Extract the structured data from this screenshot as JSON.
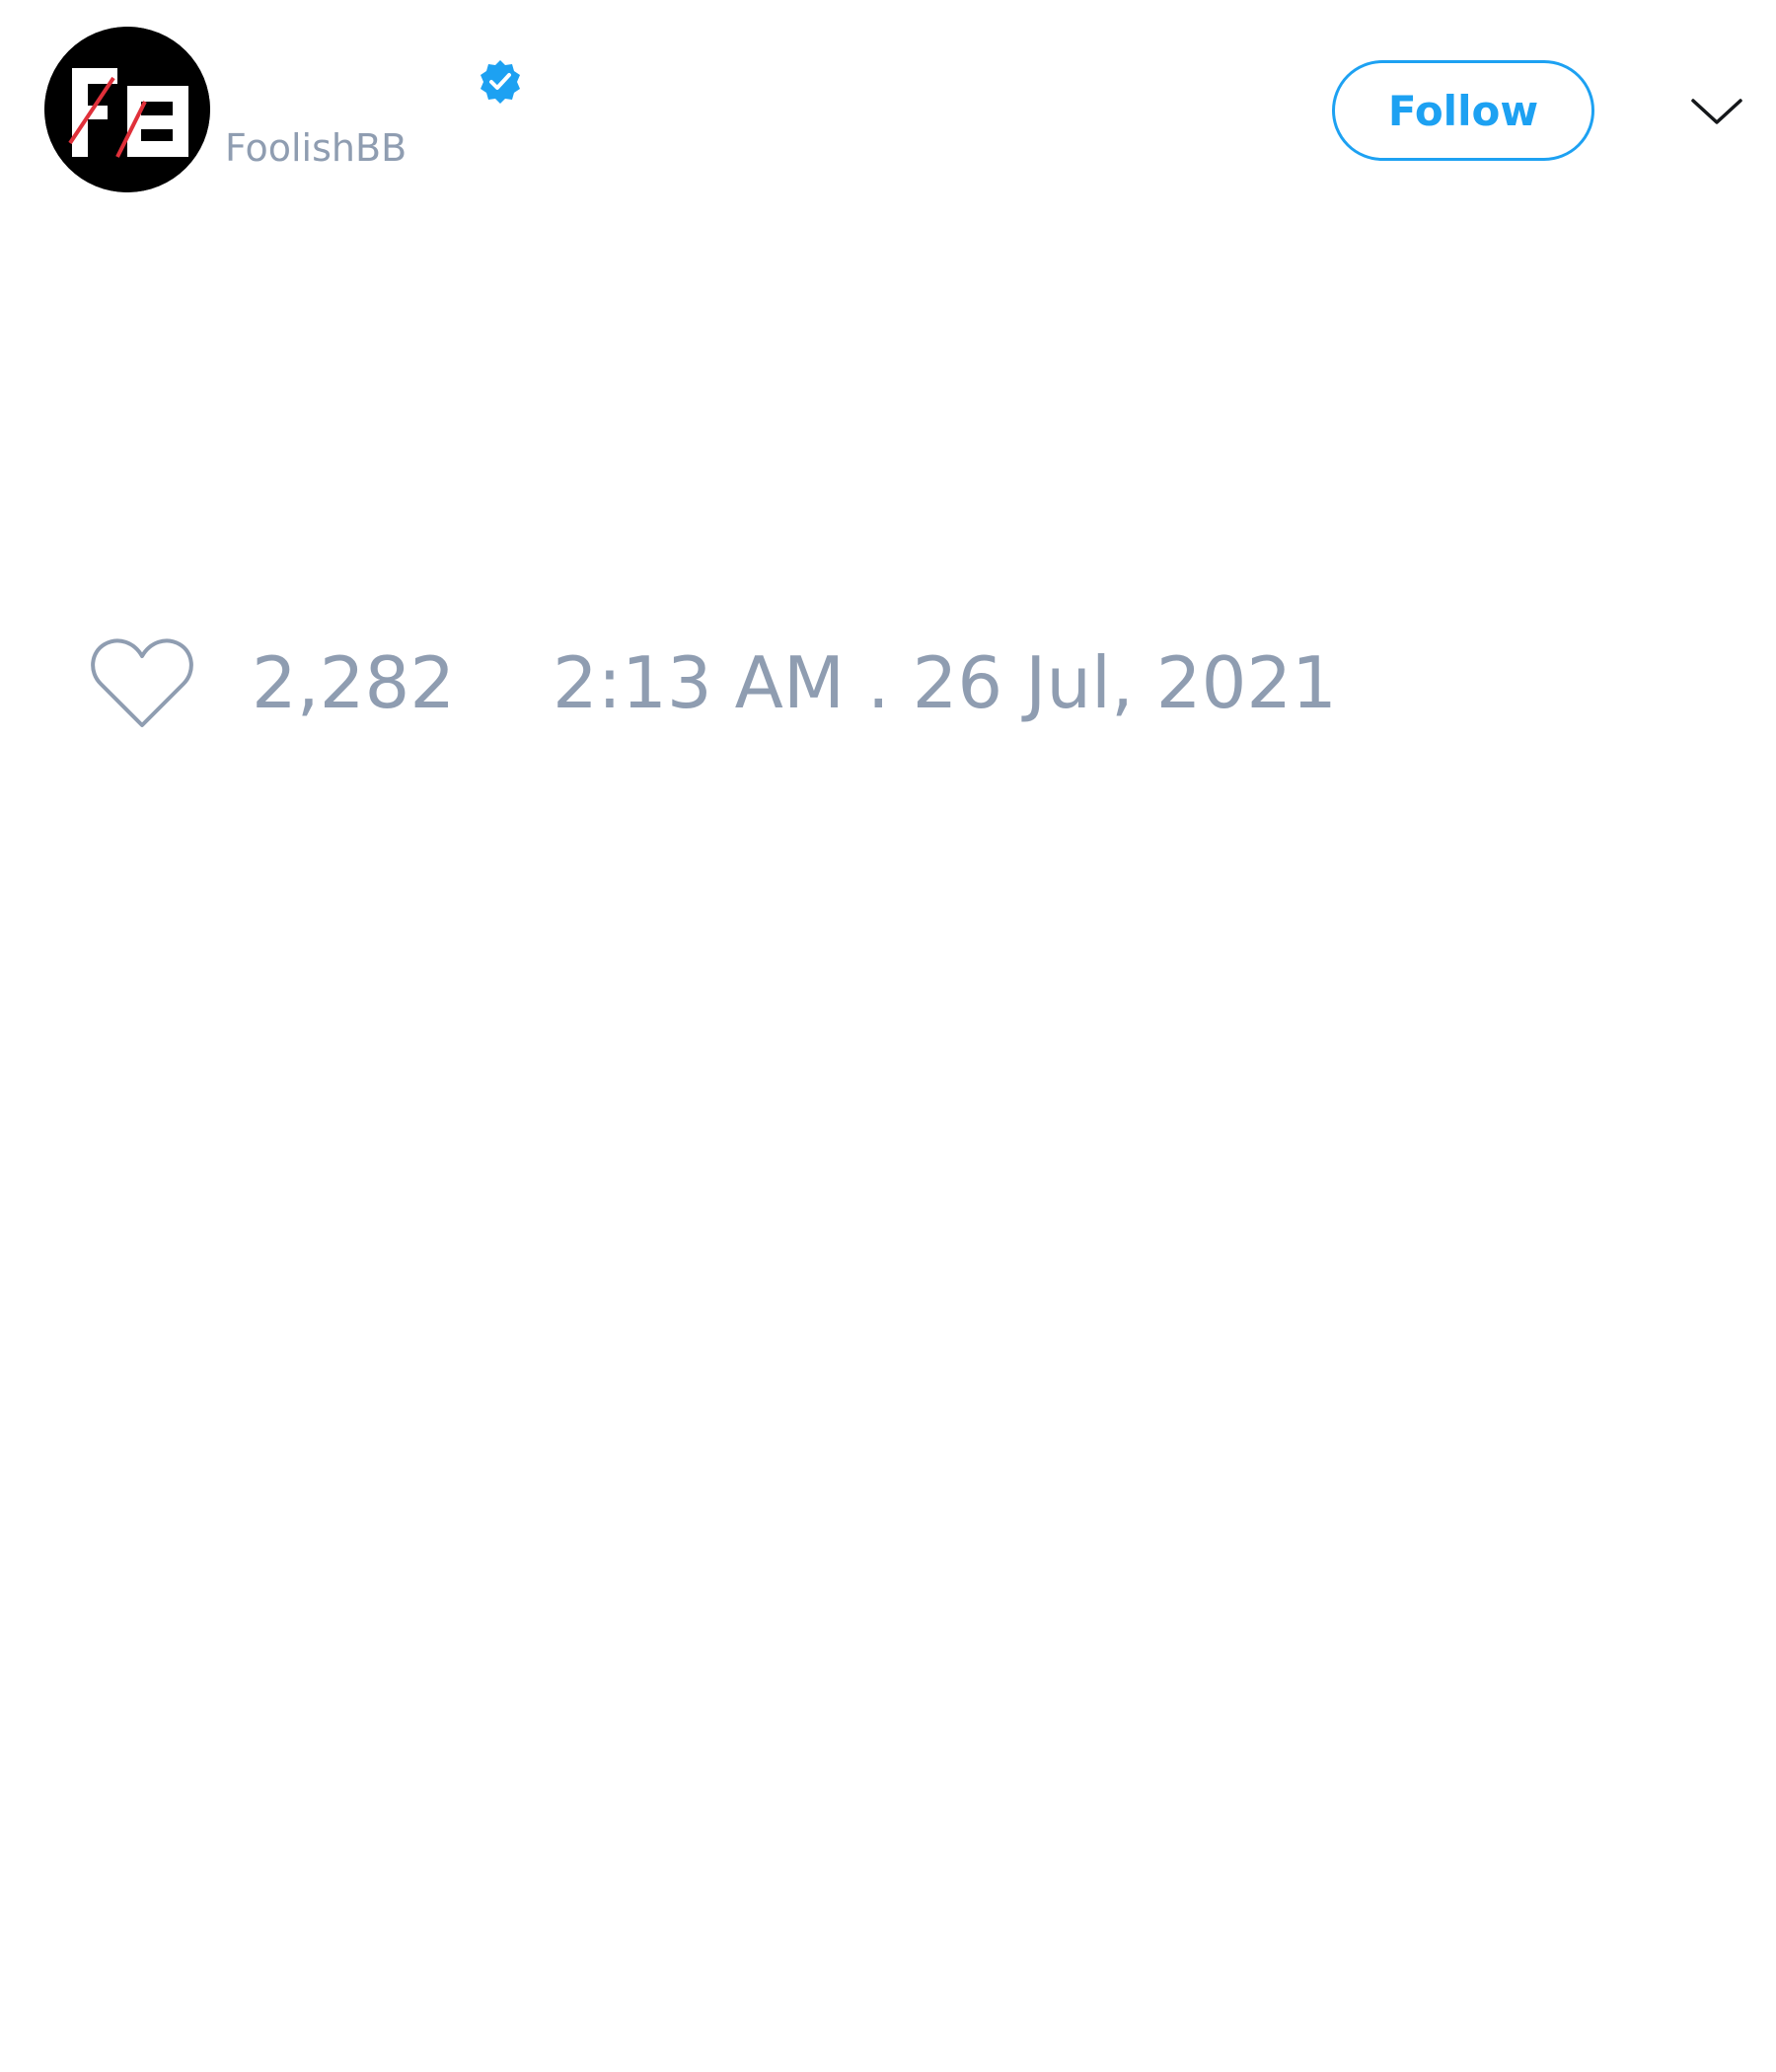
{
  "tweet": {
    "author": {
      "display_name": "",
      "handle": "FoolishBB",
      "verified": true,
      "avatar_icon": "fb-logo-avatar"
    },
    "follow_label": "Follow",
    "more_icon": "chevron-down-icon",
    "like_icon": "heart-icon",
    "like_count": "2,282",
    "timestamp": "2:13 AM . 26 Jul, 2021"
  },
  "colors": {
    "accent": "#1da1f2",
    "muted_text": "#8f9db1",
    "background": "#ffffff",
    "avatar_bg": "#000000",
    "logo_red": "#e0303a"
  }
}
